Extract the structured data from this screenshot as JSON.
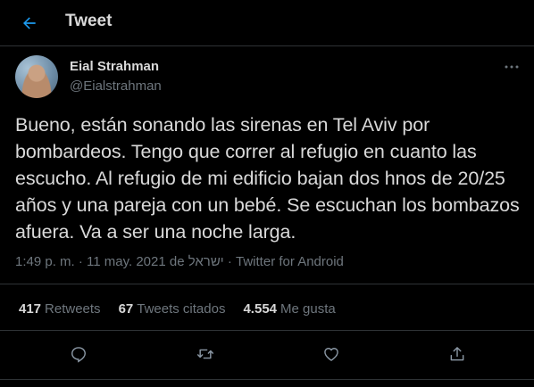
{
  "header": {
    "title": "Tweet",
    "back_icon": "arrow-left-icon"
  },
  "colors": {
    "background": "#000000",
    "accent": "#1d9bf0",
    "text": "#d9d9d9",
    "muted": "#6e767d",
    "divider": "#2f3336"
  },
  "tweet": {
    "author": {
      "name": "Eial Strahman",
      "handle": "@Eialstrahman"
    },
    "text": "Bueno, están sonando las sirenas en Tel Aviv por bombardeos. Tengo que correr al refugio en cuanto las escucho. Al refugio de mi edificio bajan dos hnos de 20/25 años y una pareja con un bebé. Se escuchan los bombazos afuera. Va a ser una noche larga.",
    "time": "1:49 p. m.",
    "date": "11 may. 2021 de ישראל",
    "source": "Twitter for Android",
    "separator": "·"
  },
  "stats": {
    "retweets": {
      "count": "417",
      "label": "Retweets"
    },
    "quotes": {
      "count": "67",
      "label": "Tweets citados"
    },
    "likes": {
      "count": "4.554",
      "label": "Me gusta"
    }
  },
  "actions": [
    "reply-icon",
    "retweet-icon",
    "like-icon",
    "share-icon"
  ]
}
